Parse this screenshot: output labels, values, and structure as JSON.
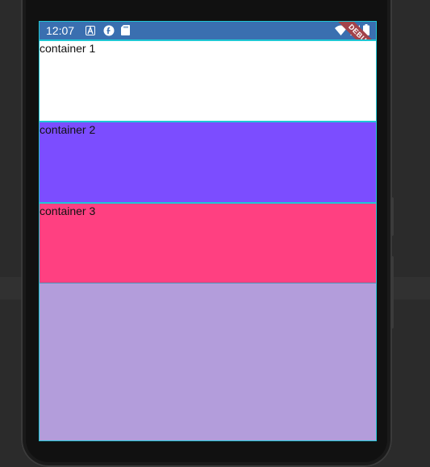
{
  "status_bar": {
    "time": "12:07",
    "left_icons": [
      "a-notification-icon",
      "f-notification-icon",
      "sd-card-icon"
    ],
    "right_icons": [
      "wifi-icon",
      "signal-icon",
      "battery-icon"
    ],
    "background": "#3a6fb0"
  },
  "debug_banner": {
    "label": "DEBUG",
    "color": "#a3434a"
  },
  "containers": [
    {
      "label": "container 1",
      "color": "#ffffff"
    },
    {
      "label": "container 2",
      "color": "#7c4dff"
    },
    {
      "label": "container 3",
      "color": "#ff4081"
    }
  ],
  "screen_background": "#b39ddb"
}
